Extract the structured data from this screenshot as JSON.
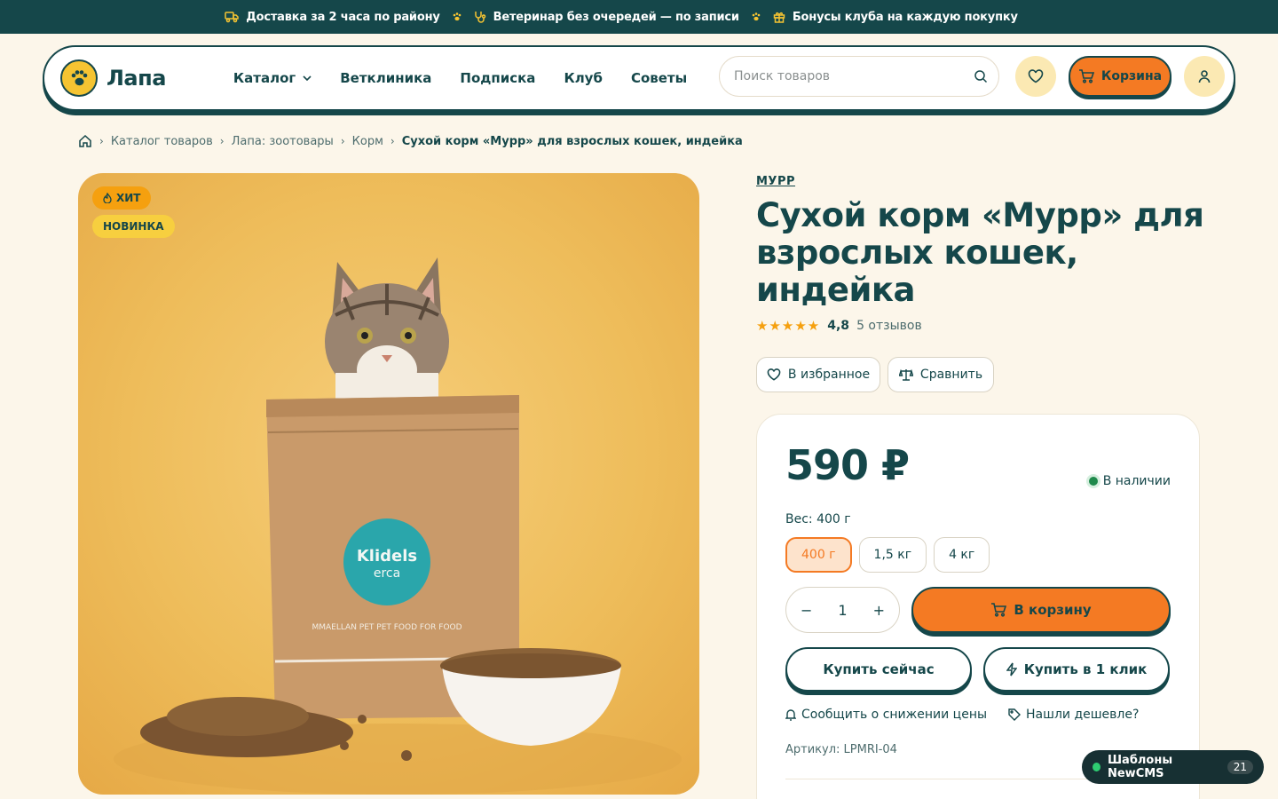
{
  "topbar": {
    "delivery": "Доставка за 2 часа по району",
    "vet": "Ветеринар без очередей — по записи",
    "bonus": "Бонусы клуба на каждую покупку"
  },
  "header": {
    "logo": "Лапа",
    "nav": [
      "Каталог",
      "Ветклиника",
      "Подписка",
      "Клуб",
      "Советы"
    ],
    "search_placeholder": "Поиск товаров",
    "cart_label": "Корзина"
  },
  "breadcrumb": [
    "Каталог товаров",
    "Лапа: зоотовары",
    "Корм",
    "Сухой корм «Мурр» для взрослых кошек, индейка"
  ],
  "badges": {
    "hit": "ХИТ",
    "new": "НОВИНКА"
  },
  "product": {
    "brand": "МУРР",
    "title": "Сухой корм «Мурр» для взрослых кошек, индейка",
    "rating": "4,8",
    "stars": 5,
    "reviews": "5 отзывов",
    "wish_label": "В избранное",
    "compare_label": "Сравнить"
  },
  "buy": {
    "price": "590 ₽",
    "stock": "В наличии",
    "weight_label": "Вес: 400 г",
    "weights": [
      "400 г",
      "1,5 кг",
      "4 кг"
    ],
    "selected_weight": "400 г",
    "quantity": "1",
    "add_to_cart": "В корзину",
    "buy_now": "Купить сейчас",
    "one_click": "Купить в 1 клик",
    "price_alert": "Сообщить о снижении цены",
    "found_cheaper": "Нашли дешевле?",
    "sku": "Артикул: LPMRI-04"
  },
  "widget": {
    "label": "Шаблоны NewCMS",
    "count": "21"
  },
  "colors": {
    "primary": "#15474a",
    "accent": "#f47a23",
    "yellow": "#f5c432",
    "background": "#fcf6ea"
  }
}
